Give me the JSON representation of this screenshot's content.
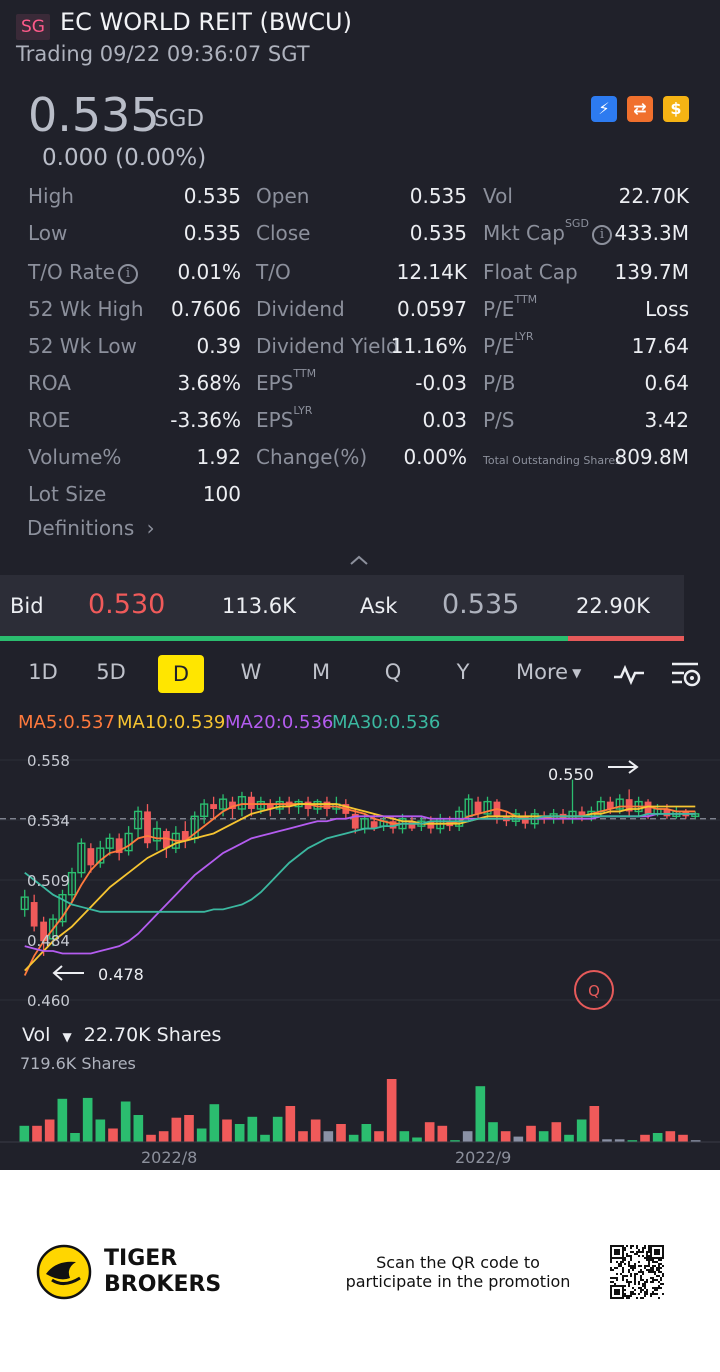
{
  "header": {
    "market": "SG",
    "title": "EC WORLD REIT (BWCU)",
    "status": "Trading 09/22 09:36:07 SGT",
    "price": "0.535",
    "currency": "SGD",
    "change": "0.000 (0.00%)",
    "feature_icons": [
      "lightning-icon",
      "exchange-icon",
      "dollar-icon"
    ]
  },
  "stats": {
    "col1": [
      {
        "label": "High",
        "value": "0.535"
      },
      {
        "label": "Low",
        "value": "0.535"
      },
      {
        "label": "T/O Rate",
        "value": "0.01%"
      },
      {
        "label": "52 Wk High",
        "value": "0.7606"
      },
      {
        "label": "52 Wk Low",
        "value": "0.39"
      },
      {
        "label": "ROA",
        "value": "3.68%"
      },
      {
        "label": "ROE",
        "value": "-3.36%"
      },
      {
        "label": "Volume%",
        "value": "1.92"
      },
      {
        "label": "Lot Size",
        "value": "100"
      }
    ],
    "col2": [
      {
        "label": "Open",
        "value": "0.535"
      },
      {
        "label": "Close",
        "value": "0.535"
      },
      {
        "label": "T/O",
        "value": "12.14K"
      },
      {
        "label": "Dividend",
        "value": "0.0597"
      },
      {
        "label": "Dividend Yield",
        "value": "11.16%"
      },
      {
        "label": "EPS",
        "sup": "TTM",
        "value": "-0.03"
      },
      {
        "label": "EPS",
        "sup": "LYR",
        "value": "0.03"
      },
      {
        "label": "Change(%)",
        "value": "0.00%"
      }
    ],
    "col3": [
      {
        "label": "Vol",
        "value": "22.70K"
      },
      {
        "label": "Mkt Cap",
        "sup": "SGD",
        "value": "433.3M"
      },
      {
        "label": "Float Cap",
        "value": "139.7M"
      },
      {
        "label": "P/E",
        "sup": "TTM",
        "value": "Loss"
      },
      {
        "label": "P/E",
        "sup": "LYR",
        "value": "17.64"
      },
      {
        "label": "P/B",
        "value": "0.64"
      },
      {
        "label": "P/S",
        "value": "3.42"
      },
      {
        "label": "Total Outstanding Shares",
        "value": "809.8M"
      }
    ],
    "definitions": "Definitions"
  },
  "bidask": {
    "bid_label": "Bid",
    "bid_price": "0.530",
    "bid_size": "113.6K",
    "ask_label": "Ask",
    "ask_price": "0.535",
    "ask_size": "22.90K"
  },
  "tabs": [
    "1D",
    "5D",
    "D",
    "W",
    "M",
    "Q",
    "Y",
    "More"
  ],
  "active_tab": "D",
  "ma": {
    "ma5": "MA5:0.537",
    "ma10": "MA10:0.539",
    "ma20": "MA20:0.536",
    "ma30": "MA30:0.536"
  },
  "colors": {
    "up": "#2bbd6f",
    "down": "#f05a5a",
    "ma5": "#ff7a3d",
    "ma10": "#f7c531",
    "ma20": "#b45cf0",
    "ma30": "#3bb8a0",
    "accent": "#ffe600"
  },
  "chart_data": [
    {
      "type": "candlestick",
      "yticks": [
        "0.558",
        "0.534",
        "0.509",
        "0.484",
        "0.460"
      ],
      "ylim": [
        0.46,
        0.558
      ],
      "high_marker": "0.550",
      "low_marker": "0.478",
      "last_price_line": 0.534,
      "candles": [
        [
          0.497,
          0.502,
          0.494,
          0.505
        ],
        [
          0.5,
          0.49,
          0.488,
          0.503
        ],
        [
          0.492,
          0.484,
          0.478,
          0.494
        ],
        [
          0.485,
          0.493,
          0.482,
          0.495
        ],
        [
          0.492,
          0.503,
          0.49,
          0.505
        ],
        [
          0.503,
          0.512,
          0.5,
          0.514
        ],
        [
          0.512,
          0.524,
          0.51,
          0.526
        ],
        [
          0.522,
          0.515,
          0.512,
          0.524
        ],
        [
          0.516,
          0.522,
          0.514,
          0.525
        ],
        [
          0.522,
          0.526,
          0.519,
          0.528
        ],
        [
          0.526,
          0.52,
          0.517,
          0.528
        ],
        [
          0.521,
          0.528,
          0.519,
          0.531
        ],
        [
          0.53,
          0.537,
          0.526,
          0.539
        ],
        [
          0.537,
          0.524,
          0.522,
          0.54
        ],
        [
          0.525,
          0.53,
          0.521,
          0.533
        ],
        [
          0.529,
          0.522,
          0.518,
          0.53
        ],
        [
          0.522,
          0.528,
          0.52,
          0.531
        ],
        [
          0.529,
          0.525,
          0.522,
          0.533
        ],
        [
          0.526,
          0.535,
          0.524,
          0.537
        ],
        [
          0.535,
          0.54,
          0.532,
          0.542
        ],
        [
          0.54,
          0.538,
          0.534,
          0.543
        ],
        [
          0.538,
          0.542,
          0.535,
          0.544
        ],
        [
          0.541,
          0.538,
          0.534,
          0.543
        ],
        [
          0.538,
          0.543,
          0.535,
          0.545
        ],
        [
          0.543,
          0.538,
          0.535,
          0.545
        ],
        [
          0.538,
          0.541,
          0.536,
          0.543
        ],
        [
          0.54,
          0.538,
          0.535,
          0.542
        ],
        [
          0.538,
          0.541,
          0.536,
          0.543
        ],
        [
          0.541,
          0.539,
          0.536,
          0.543
        ],
        [
          0.539,
          0.541,
          0.536,
          0.542
        ],
        [
          0.541,
          0.538,
          0.535,
          0.543
        ],
        [
          0.538,
          0.541,
          0.536,
          0.542
        ],
        [
          0.541,
          0.538,
          0.535,
          0.543
        ],
        [
          0.538,
          0.54,
          0.536,
          0.543
        ],
        [
          0.54,
          0.536,
          0.534,
          0.542
        ],
        [
          0.536,
          0.53,
          0.528,
          0.538
        ],
        [
          0.53,
          0.534,
          0.528,
          0.536
        ],
        [
          0.533,
          0.53,
          0.529,
          0.536
        ],
        [
          0.531,
          0.533,
          0.529,
          0.535
        ],
        [
          0.533,
          0.53,
          0.528,
          0.535
        ],
        [
          0.53,
          0.534,
          0.528,
          0.536
        ],
        [
          0.533,
          0.53,
          0.529,
          0.535
        ],
        [
          0.531,
          0.533,
          0.529,
          0.535
        ],
        [
          0.533,
          0.53,
          0.528,
          0.535
        ],
        [
          0.53,
          0.534,
          0.528,
          0.536
        ],
        [
          0.533,
          0.531,
          0.529,
          0.535
        ],
        [
          0.531,
          0.537,
          0.529,
          0.539
        ],
        [
          0.535,
          0.542,
          0.533,
          0.544
        ],
        [
          0.541,
          0.536,
          0.534,
          0.543
        ],
        [
          0.536,
          0.541,
          0.534,
          0.543
        ],
        [
          0.541,
          0.535,
          0.532,
          0.542
        ],
        [
          0.535,
          0.533,
          0.531,
          0.537
        ],
        [
          0.533,
          0.536,
          0.531,
          0.538
        ],
        [
          0.535,
          0.532,
          0.53,
          0.537
        ],
        [
          0.532,
          0.536,
          0.53,
          0.538
        ],
        [
          0.535,
          0.534,
          0.532,
          0.537
        ],
        [
          0.534,
          0.536,
          0.532,
          0.538
        ],
        [
          0.536,
          0.534,
          0.532,
          0.538
        ],
        [
          0.534,
          0.537,
          0.532,
          0.55
        ],
        [
          0.537,
          0.535,
          0.533,
          0.539
        ],
        [
          0.535,
          0.537,
          0.533,
          0.539
        ],
        [
          0.537,
          0.541,
          0.535,
          0.543
        ],
        [
          0.541,
          0.538,
          0.536,
          0.543
        ],
        [
          0.538,
          0.542,
          0.536,
          0.544
        ],
        [
          0.542,
          0.537,
          0.535,
          0.546
        ],
        [
          0.537,
          0.541,
          0.535,
          0.543
        ],
        [
          0.541,
          0.536,
          0.534,
          0.542
        ],
        [
          0.536,
          0.538,
          0.535,
          0.54
        ],
        [
          0.538,
          0.535,
          0.534,
          0.54
        ],
        [
          0.535,
          0.537,
          0.534,
          0.539
        ],
        [
          0.537,
          0.535,
          0.534,
          0.538
        ],
        [
          0.535,
          0.536,
          0.534,
          0.537
        ]
      ],
      "ma_lines": {
        "ma5": [
          0.47,
          0.478,
          0.484,
          0.489,
          0.494,
          0.5,
          0.507,
          0.513,
          0.517,
          0.52,
          0.521,
          0.523,
          0.526,
          0.527,
          0.526,
          0.526,
          0.525,
          0.525,
          0.528,
          0.531,
          0.534,
          0.537,
          0.539,
          0.54,
          0.54,
          0.54,
          0.54,
          0.54,
          0.54,
          0.54,
          0.54,
          0.539,
          0.539,
          0.539,
          0.538,
          0.537,
          0.536,
          0.534,
          0.533,
          0.532,
          0.532,
          0.532,
          0.532,
          0.532,
          0.532,
          0.532,
          0.533,
          0.535,
          0.536,
          0.537,
          0.538,
          0.537,
          0.535,
          0.534,
          0.534,
          0.534,
          0.535,
          0.535,
          0.535,
          0.535,
          0.536,
          0.537,
          0.538,
          0.539,
          0.539,
          0.539,
          0.539,
          0.538,
          0.538,
          0.537,
          0.537,
          0.537
        ],
        "ma10": [
          0.472,
          0.476,
          0.48,
          0.484,
          0.487,
          0.49,
          0.494,
          0.498,
          0.502,
          0.506,
          0.509,
          0.512,
          0.515,
          0.518,
          0.52,
          0.522,
          0.524,
          0.525,
          0.526,
          0.527,
          0.528,
          0.53,
          0.532,
          0.534,
          0.536,
          0.537,
          0.538,
          0.539,
          0.539,
          0.54,
          0.54,
          0.54,
          0.54,
          0.54,
          0.539,
          0.538,
          0.537,
          0.536,
          0.535,
          0.534,
          0.533,
          0.533,
          0.532,
          0.532,
          0.532,
          0.532,
          0.532,
          0.533,
          0.534,
          0.535,
          0.535,
          0.535,
          0.535,
          0.535,
          0.535,
          0.535,
          0.535,
          0.535,
          0.535,
          0.535,
          0.536,
          0.536,
          0.537,
          0.537,
          0.538,
          0.538,
          0.539,
          0.539,
          0.539,
          0.539,
          0.539,
          0.539
        ],
        "ma20": [
          0.482,
          0.481,
          0.48,
          0.48,
          0.479,
          0.479,
          0.479,
          0.479,
          0.48,
          0.481,
          0.482,
          0.484,
          0.487,
          0.491,
          0.495,
          0.499,
          0.503,
          0.507,
          0.511,
          0.514,
          0.517,
          0.52,
          0.522,
          0.524,
          0.526,
          0.527,
          0.528,
          0.529,
          0.53,
          0.531,
          0.532,
          0.533,
          0.533,
          0.534,
          0.534,
          0.535,
          0.535,
          0.535,
          0.535,
          0.535,
          0.535,
          0.535,
          0.535,
          0.534,
          0.534,
          0.534,
          0.534,
          0.534,
          0.534,
          0.534,
          0.534,
          0.534,
          0.534,
          0.534,
          0.534,
          0.534,
          0.534,
          0.534,
          0.534,
          0.534,
          0.534,
          0.535,
          0.535,
          0.535,
          0.535,
          0.535,
          0.535,
          0.536,
          0.536,
          0.536,
          0.536,
          0.536
        ],
        "ma30": [
          0.512,
          0.509,
          0.506,
          0.503,
          0.501,
          0.499,
          0.498,
          0.497,
          0.496,
          0.496,
          0.496,
          0.496,
          0.496,
          0.496,
          0.496,
          0.496,
          0.496,
          0.496,
          0.496,
          0.496,
          0.497,
          0.497,
          0.498,
          0.499,
          0.501,
          0.504,
          0.508,
          0.512,
          0.516,
          0.519,
          0.522,
          0.524,
          0.526,
          0.527,
          0.528,
          0.529,
          0.53,
          0.53,
          0.531,
          0.531,
          0.532,
          0.532,
          0.532,
          0.533,
          0.533,
          0.533,
          0.533,
          0.533,
          0.534,
          0.534,
          0.534,
          0.534,
          0.534,
          0.534,
          0.534,
          0.535,
          0.535,
          0.535,
          0.535,
          0.535,
          0.535,
          0.535,
          0.535,
          0.535,
          0.535,
          0.535,
          0.536,
          0.536,
          0.536,
          0.536,
          0.536,
          0.536
        ]
      }
    },
    {
      "type": "bar",
      "label": "Vol",
      "summary": "22.70K Shares",
      "max_label": "719.6K Shares",
      "x_labels": [
        "2022/8",
        "2022/9"
      ],
      "bars": [
        [
          0.18,
          "up"
        ],
        [
          0.18,
          "down"
        ],
        [
          0.25,
          "down"
        ],
        [
          0.48,
          "up"
        ],
        [
          0.1,
          "up"
        ],
        [
          0.49,
          "up"
        ],
        [
          0.25,
          "up"
        ],
        [
          0.15,
          "down"
        ],
        [
          0.45,
          "up"
        ],
        [
          0.3,
          "up"
        ],
        [
          0.08,
          "down"
        ],
        [
          0.12,
          "down"
        ],
        [
          0.27,
          "down"
        ],
        [
          0.3,
          "down"
        ],
        [
          0.15,
          "up"
        ],
        [
          0.42,
          "up"
        ],
        [
          0.25,
          "down"
        ],
        [
          0.2,
          "up"
        ],
        [
          0.28,
          "up"
        ],
        [
          0.08,
          "up"
        ],
        [
          0.28,
          "up"
        ],
        [
          0.4,
          "down"
        ],
        [
          0.12,
          "down"
        ],
        [
          0.25,
          "down"
        ],
        [
          0.12,
          "flat"
        ],
        [
          0.2,
          "down"
        ],
        [
          0.08,
          "up"
        ],
        [
          0.2,
          "up"
        ],
        [
          0.12,
          "down"
        ],
        [
          0.7,
          "down"
        ],
        [
          0.12,
          "up"
        ],
        [
          0.05,
          "up"
        ],
        [
          0.22,
          "down"
        ],
        [
          0.18,
          "down"
        ],
        [
          0.02,
          "up"
        ],
        [
          0.12,
          "flat"
        ],
        [
          0.62,
          "up"
        ],
        [
          0.22,
          "up"
        ],
        [
          0.12,
          "down"
        ],
        [
          0.06,
          "flat"
        ],
        [
          0.18,
          "down"
        ],
        [
          0.12,
          "up"
        ],
        [
          0.22,
          "down"
        ],
        [
          0.08,
          "up"
        ],
        [
          0.25,
          "up"
        ],
        [
          0.4,
          "down"
        ],
        [
          0.03,
          "flat"
        ],
        [
          0.03,
          "flat"
        ],
        [
          0.02,
          "up"
        ],
        [
          0.08,
          "down"
        ],
        [
          0.1,
          "up"
        ],
        [
          0.12,
          "down"
        ],
        [
          0.08,
          "down"
        ],
        [
          0.02,
          "flat"
        ]
      ]
    }
  ],
  "footer": {
    "brand_line1": "TIGER",
    "brand_line2": "BROKERS",
    "promo_line1": "Scan the QR code to",
    "promo_line2": "participate in the promotion"
  }
}
